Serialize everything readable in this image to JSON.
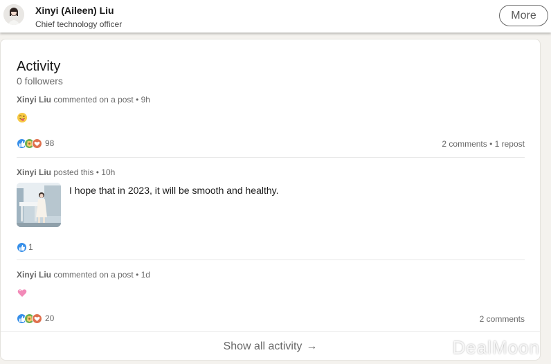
{
  "header": {
    "name": "Xinyi (Aileen) Liu",
    "headline": "Chief technology officer",
    "more_label": "More"
  },
  "activity": {
    "title": "Activity",
    "followers": "0 followers",
    "items": [
      {
        "author": "Xinyi Liu",
        "action": "commented on a post • 9h",
        "emoji": "tongue-face-emoji",
        "reaction_count": "98",
        "right_counts": "2 comments • 1 repost"
      },
      {
        "author": "Xinyi Liu",
        "action": "posted this • 10h",
        "text": "I hope that in 2023, it will be smooth and healthy.",
        "reaction_count": "1"
      },
      {
        "author": "Xinyi Liu",
        "action": "commented on a post • 1d",
        "emoji": "pink-heart-emoji",
        "reaction_count": "20",
        "right_counts": "2 comments"
      }
    ],
    "show_all_label": "Show all activity",
    "show_all_arrow": "→"
  },
  "watermark": "DealMoon",
  "colors": {
    "like_blue": "#378fe9",
    "celebrate_green": "#6dae4f",
    "support_orange": "#e6a13b",
    "love_red": "#df704d",
    "accent_text": "rgba(0,0,0,0.6)"
  }
}
